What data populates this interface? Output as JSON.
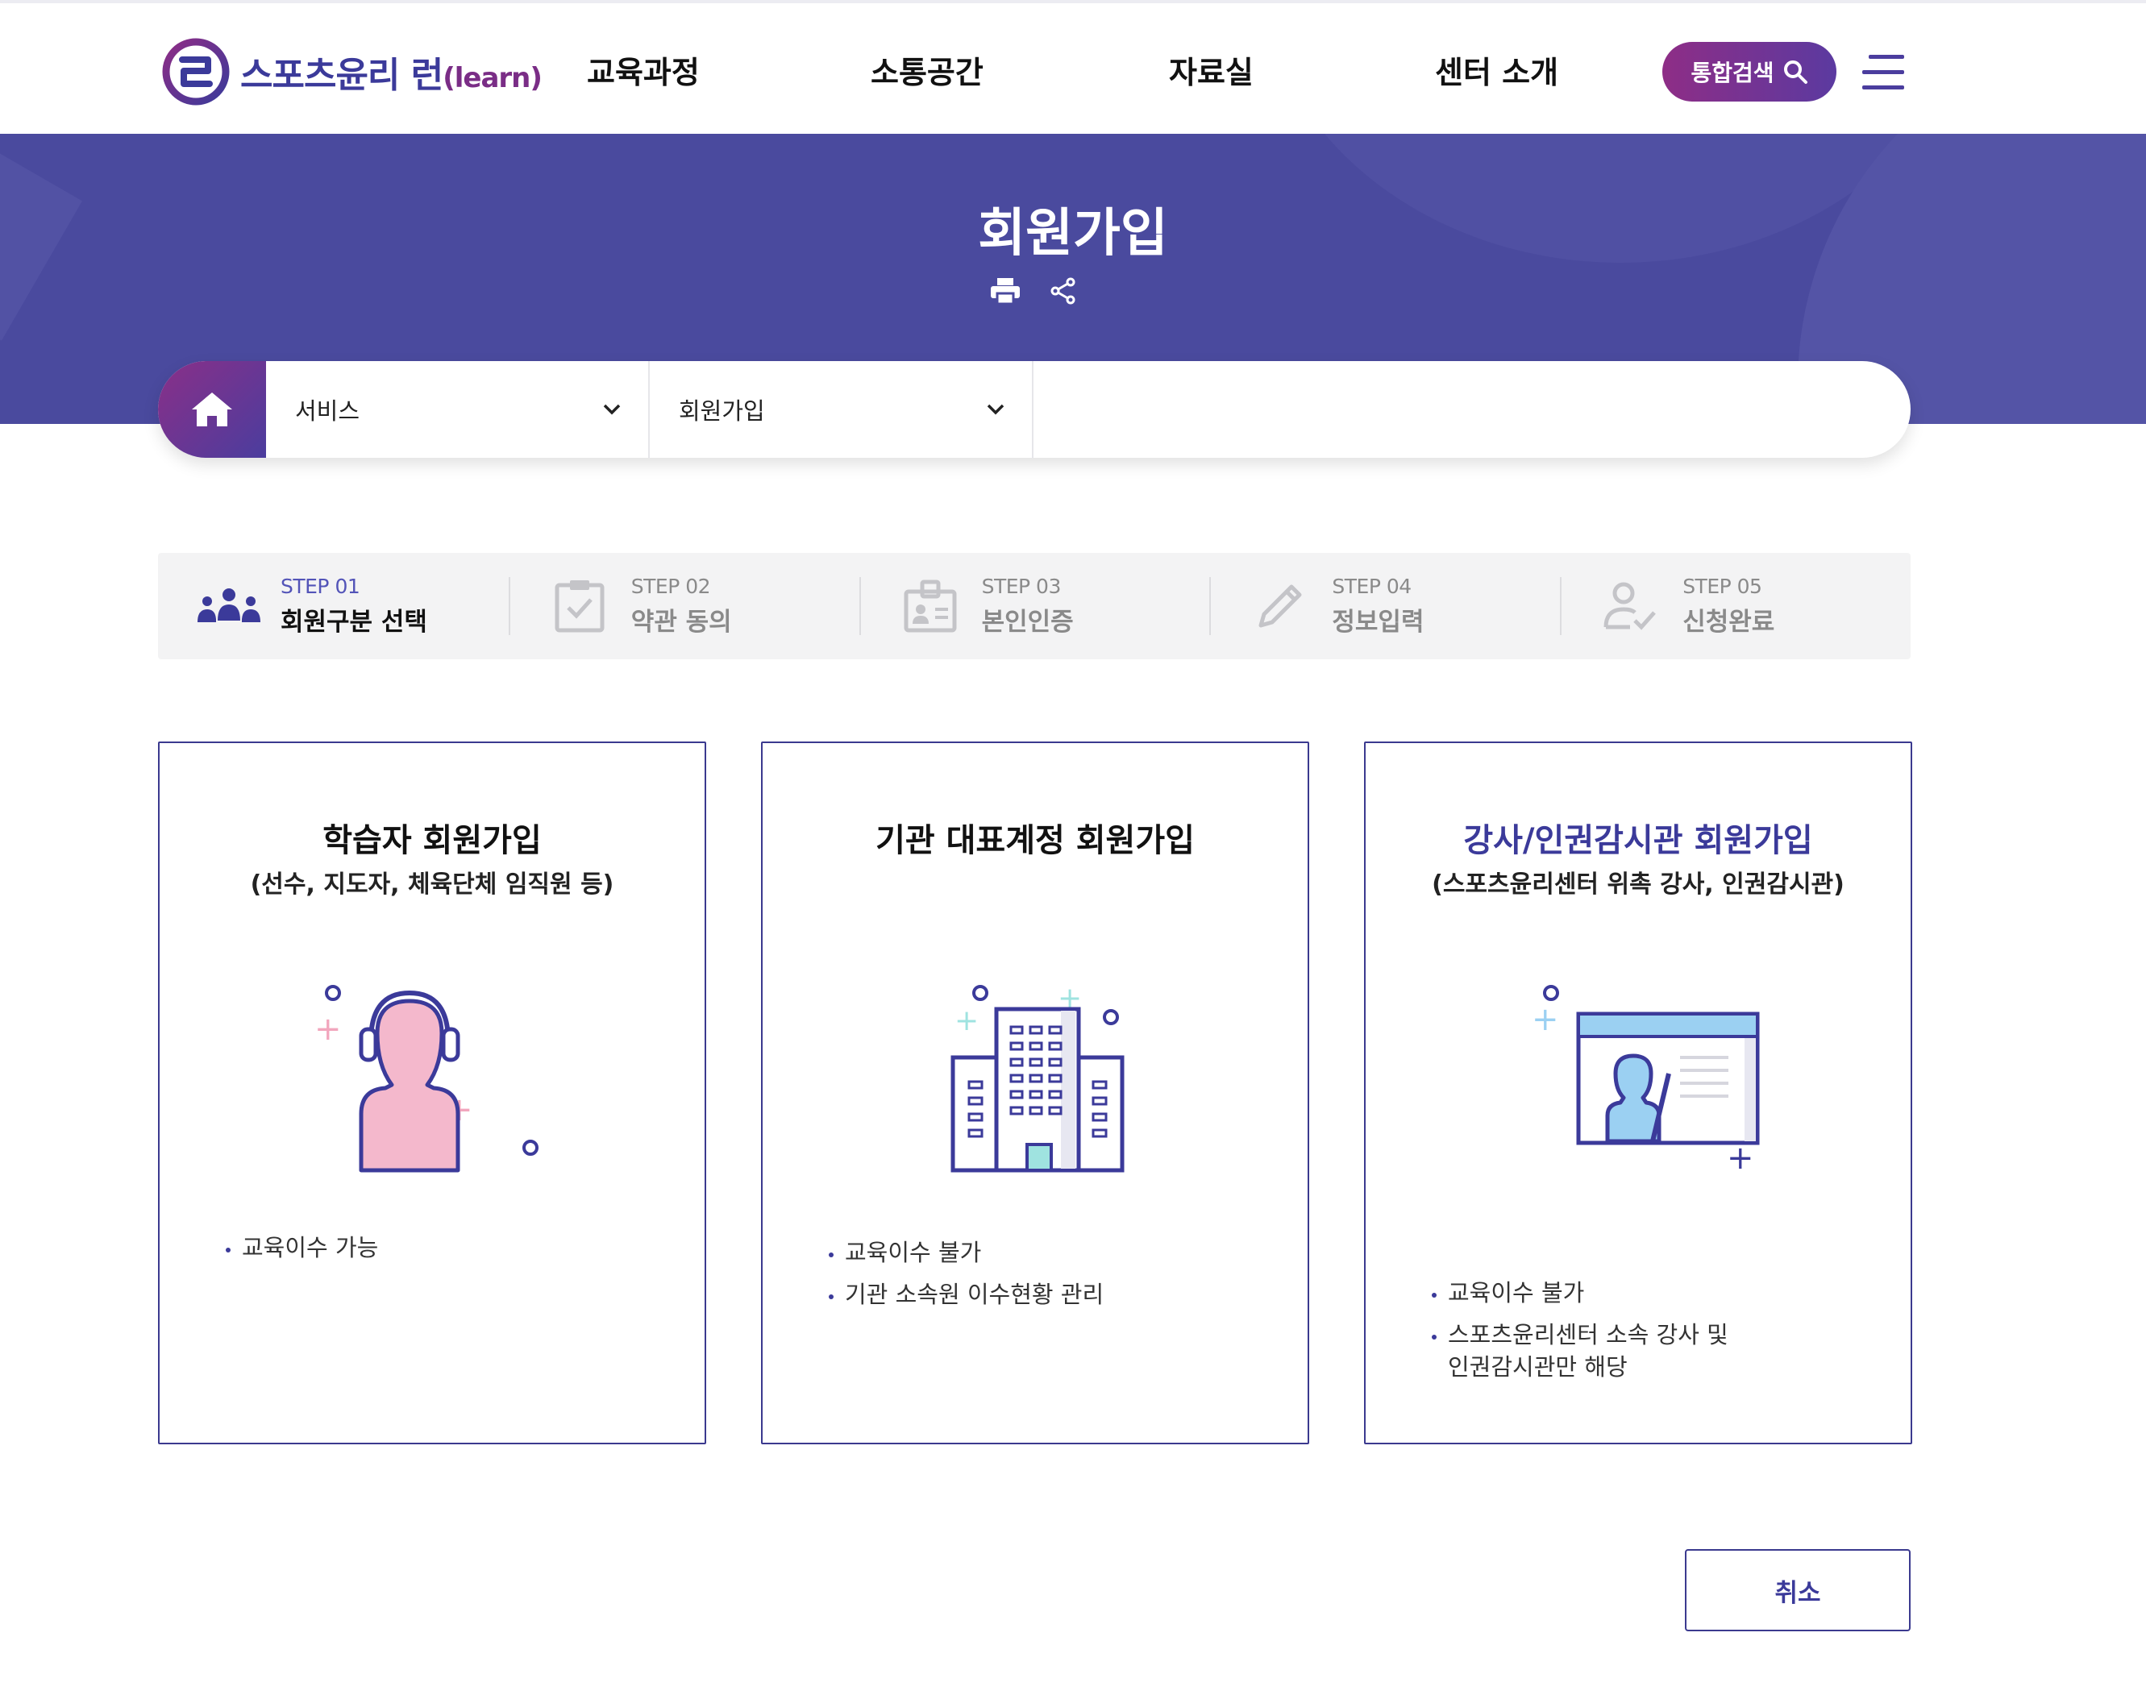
{
  "header": {
    "logo_text": "스포츠윤리 런",
    "logo_suffix": "(learn)",
    "nav": [
      "교육과정",
      "소통공간",
      "자료실",
      "센터 소개"
    ],
    "search_label": "통합검색"
  },
  "banner": {
    "title": "회원가입"
  },
  "breadcrumb": {
    "level1": "서비스",
    "level2": "회원가입"
  },
  "steps": [
    {
      "num": "STEP 01",
      "label": "회원구분 선택",
      "icon": "people-group-icon",
      "active": true
    },
    {
      "num": "STEP 02",
      "label": "약관 동의",
      "icon": "clipboard-check-icon",
      "active": false
    },
    {
      "num": "STEP 03",
      "label": "본인인증",
      "icon": "id-card-icon",
      "active": false
    },
    {
      "num": "STEP 04",
      "label": "정보입력",
      "icon": "pencil-icon",
      "active": false
    },
    {
      "num": "STEP 05",
      "label": "신청완료",
      "icon": "user-check-icon",
      "active": false
    }
  ],
  "cards": [
    {
      "title": "학습자 회원가입",
      "subtitle": "(선수, 지도자, 체육단체 임직원 등)",
      "icon": "headset-person-icon",
      "bullets": [
        "교육이수 가능"
      ]
    },
    {
      "title": "기관 대표계정 회원가입",
      "subtitle": "",
      "icon": "building-icon",
      "bullets": [
        "교육이수 불가",
        "기관 소속원 이수현황 관리"
      ]
    },
    {
      "title": "강사/인권감시관 회원가입",
      "subtitle": "(스포츠윤리센터 위촉 강사, 인권감시관)",
      "icon": "lecturer-screen-icon",
      "bullets": [
        "교육이수 불가",
        "스포츠윤리센터 소속 강사 및",
        "인권감시관만 해당"
      ]
    }
  ],
  "cancel_label": "취소",
  "colors": {
    "brand_purple": "#4a4a9e",
    "accent_magenta": "#8e2d86",
    "active_step": "#5354b8"
  }
}
